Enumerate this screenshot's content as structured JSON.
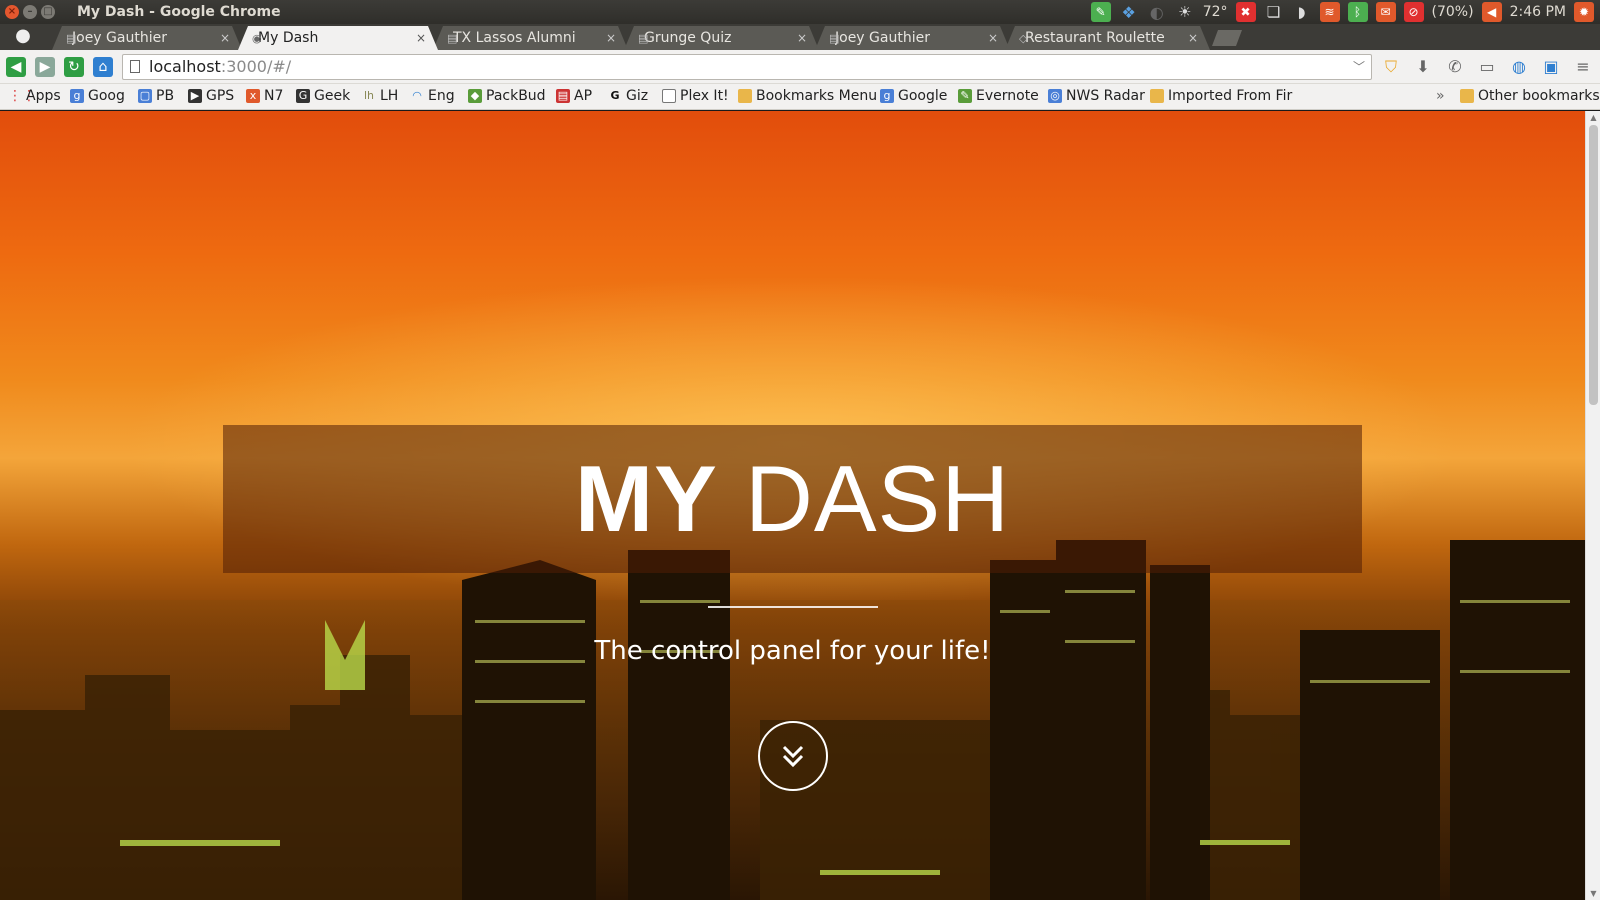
{
  "window": {
    "title": "My Dash - Google Chrome",
    "buttons": {
      "close": "×",
      "minimize": "–",
      "maximize": "□"
    }
  },
  "indicators": {
    "temperature": "72°",
    "battery": "(70%)",
    "time": "2:46 PM"
  },
  "tabs": [
    {
      "label": "Joey Gauthier",
      "favicon": "page-icon",
      "active": false
    },
    {
      "label": "My Dash",
      "favicon": "globe-icon",
      "active": true
    },
    {
      "label": "TX Lassos Alumni",
      "favicon": "page-icon",
      "active": false
    },
    {
      "label": "Grunge Quiz",
      "favicon": "page-icon",
      "active": false
    },
    {
      "label": "Joey Gauthier",
      "favicon": "page-icon",
      "active": false
    },
    {
      "label": "Restaurant Roulette",
      "favicon": "code-icon",
      "active": false
    }
  ],
  "tab_close": "×",
  "omnibox": {
    "host": "localhost",
    "path": ":3000/#/"
  },
  "bookmarks": [
    {
      "label": "Apps",
      "icon": "apps-grid-icon"
    },
    {
      "label": "Goog",
      "icon": "google-icon"
    },
    {
      "label": "PB",
      "icon": "pb-icon"
    },
    {
      "label": "GPS",
      "icon": "play-icon"
    },
    {
      "label": "N7",
      "icon": "xda-icon"
    },
    {
      "label": "Geek",
      "icon": "geek-icon"
    },
    {
      "label": "LH",
      "icon": "lh-icon"
    },
    {
      "label": "Eng",
      "icon": "feed-icon"
    },
    {
      "label": "PackBud",
      "icon": "android-icon"
    },
    {
      "label": "AP",
      "icon": "ap-icon"
    },
    {
      "label": "Giz",
      "icon": "giz-icon"
    },
    {
      "label": "Plex It!",
      "icon": "page-icon"
    },
    {
      "label": "Bookmarks Menu",
      "icon": "folder-icon"
    },
    {
      "label": "Google",
      "icon": "google-icon"
    },
    {
      "label": "Evernote",
      "icon": "evernote-icon"
    },
    {
      "label": "NWS Radar",
      "icon": "radar-icon"
    },
    {
      "label": "Imported From Fir",
      "icon": "folder-icon"
    }
  ],
  "bookmarks_overflow": "»",
  "other_bookmarks": "Other bookmarks",
  "hero": {
    "title_bold": "MY",
    "title_light": "DASH",
    "tagline": "The control panel for your life!",
    "scroll_icon": "double-chevron-down-icon"
  },
  "colors": {
    "sky_top": "#e24d0c",
    "sky_glow": "#f4a53a",
    "city_dark": "#2f1a05",
    "hero_band": "rgba(80,30,5,0.55)",
    "chrome_frame": "#3c3b37",
    "toolbar": "#f2f1f0"
  }
}
